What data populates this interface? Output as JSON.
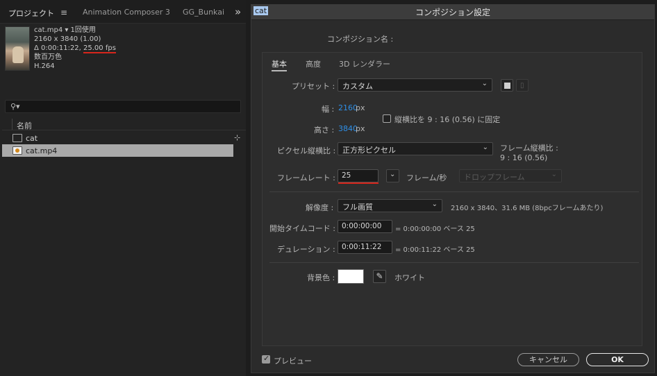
{
  "project_panel": {
    "tab_project": "プロジェクト",
    "tab_menu_icon": "hamburger-icon",
    "tab_animation_composer": "Animation Composer 3",
    "tab_gg": "GG_Bunkai",
    "more_icon": "double-chevron-right-icon",
    "file_info": {
      "name_line": "cat.mp4 ▾  1回使用",
      "resolution": "2160 x 3840 (1.00)",
      "duration_prefix": "Δ 0:00:11:22, ",
      "fps": "25.00 fps",
      "colors": "数百万色",
      "codec": "H.264"
    },
    "search": {
      "placeholder": "",
      "icon": "search-icon"
    },
    "list_header": "名前",
    "items": [
      {
        "name": "cat",
        "icon": "composition-icon"
      },
      {
        "name": "cat.mp4",
        "icon": "footage-icon"
      }
    ],
    "flowchart_icon": "flowchart-icon"
  },
  "dialog": {
    "title": "コンポジション設定",
    "comp_name_label": "コンポジション名 :",
    "comp_name_value": "cat",
    "tabs": [
      "基本",
      "高度",
      "3D レンダラー"
    ],
    "preset_label": "プリセット :",
    "preset_value": "カスタム",
    "width_label": "幅 :",
    "width_value": "2160",
    "width_unit": "px",
    "height_label": "高さ :",
    "height_value": "3840",
    "height_unit": "px",
    "lock_aspect_label": "縦横比を 9 : 16 (0.56) に固定",
    "pixel_aspect_label": "ピクセル縦横比 :",
    "pixel_aspect_value": "正方形ピクセル",
    "frame_aspect_label": "フレーム縦横比 :",
    "frame_aspect_value": "9 : 16 (0.56)",
    "frame_rate_label": "フレームレート :",
    "frame_rate_value": "25",
    "frame_rate_unit": "フレーム/秒",
    "drop_frame_value": "ドロップフレーム",
    "resolution_label": "解像度 :",
    "resolution_value": "フル画質",
    "resolution_info": "2160 x 3840、31.6 MB (8bpcフレームあたり)",
    "start_tc_label": "開始タイムコード :",
    "start_tc_value": "0:00:00:00",
    "start_tc_info": "= 0:00:00:00  ベース 25",
    "duration_label": "デュレーション :",
    "duration_value": "0:00:11:22",
    "duration_info": "= 0:00:11:22  ベース 25",
    "bg_color_label": "背景色 :",
    "bg_color_value": "#ffffff",
    "bg_color_name": "ホワイト",
    "preview_label": "プレビュー",
    "cancel_label": "キャンセル",
    "ok_label": "OK"
  },
  "colors": {
    "accent_blue": "#2e8fe7",
    "annotation_red": "#d8261c"
  }
}
